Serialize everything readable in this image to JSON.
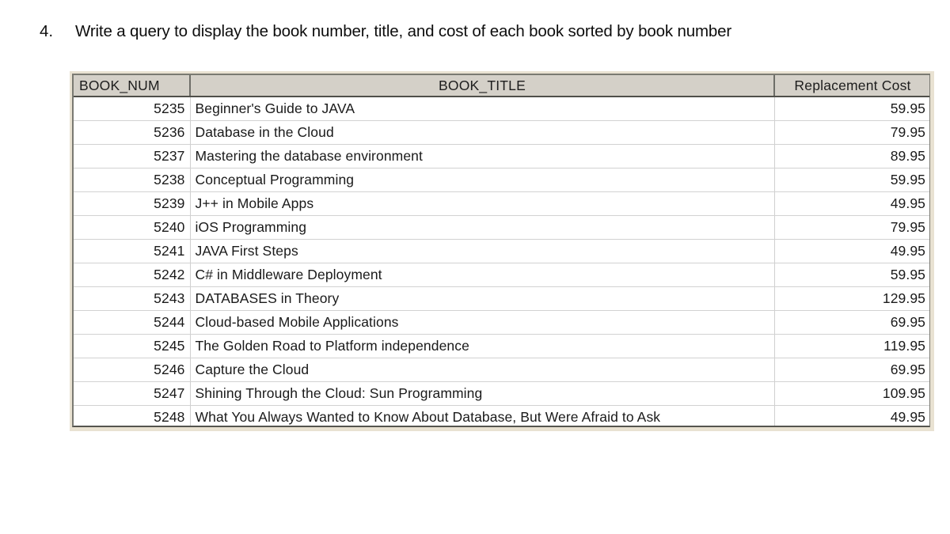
{
  "question": {
    "number": "4.",
    "text": "Write a query to display the book number, title, and cost of each book sorted by book number"
  },
  "grid": {
    "columns": [
      {
        "key": "book_num",
        "label": "BOOK_NUM",
        "align": "right"
      },
      {
        "key": "book_title",
        "label": "BOOK_TITLE",
        "align": "left"
      },
      {
        "key": "replacement_cost",
        "label": "Replacement Cost",
        "align": "right"
      }
    ],
    "rows": [
      {
        "book_num": "5235",
        "book_title": "Beginner's Guide to JAVA",
        "replacement_cost": "59.95"
      },
      {
        "book_num": "5236",
        "book_title": "Database in the Cloud",
        "replacement_cost": "79.95"
      },
      {
        "book_num": "5237",
        "book_title": "Mastering the database environment",
        "replacement_cost": "89.95"
      },
      {
        "book_num": "5238",
        "book_title": "Conceptual Programming",
        "replacement_cost": "59.95"
      },
      {
        "book_num": "5239",
        "book_title": "J++ in Mobile Apps",
        "replacement_cost": "49.95"
      },
      {
        "book_num": "5240",
        "book_title": "iOS Programming",
        "replacement_cost": "79.95"
      },
      {
        "book_num": "5241",
        "book_title": "JAVA First Steps",
        "replacement_cost": "49.95"
      },
      {
        "book_num": "5242",
        "book_title": "C# in Middleware Deployment",
        "replacement_cost": "59.95"
      },
      {
        "book_num": "5243",
        "book_title": "DATABASES in Theory",
        "replacement_cost": "129.95"
      },
      {
        "book_num": "5244",
        "book_title": "Cloud-based Mobile Applications",
        "replacement_cost": "69.95"
      },
      {
        "book_num": "5245",
        "book_title": "The Golden Road to Platform independence",
        "replacement_cost": "119.95"
      },
      {
        "book_num": "5246",
        "book_title": "Capture the Cloud",
        "replacement_cost": "69.95"
      },
      {
        "book_num": "5247",
        "book_title": "Shining Through the Cloud: Sun Programming",
        "replacement_cost": "109.95"
      },
      {
        "book_num": "5248",
        "book_title": "What You Always Wanted to Know About Database, But Were Afraid to Ask",
        "replacement_cost": "49.95"
      }
    ],
    "row_count": 14
  },
  "colors": {
    "header_background": "#d4d0c8",
    "frame_background": "#e9e2d2",
    "grid_line": "#d2d2d2",
    "border_dark": "#6e6e68",
    "cell_background": "#ffffff",
    "text": "#1a1a1a"
  }
}
